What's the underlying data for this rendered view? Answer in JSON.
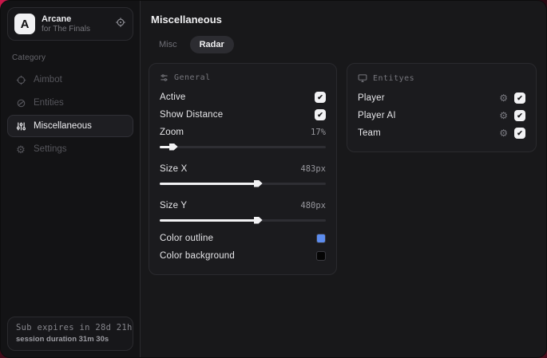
{
  "icons": {
    "check": "✔",
    "gear": "⚙"
  },
  "colors": {
    "accent_blue": "#5c8cee",
    "swatch_black": "#050505",
    "desktop_red": "#c9174a"
  },
  "sidebar": {
    "brand": {
      "initial": "A",
      "name": "Arcane",
      "subtitle": "for The Finals"
    },
    "category_label": "Category",
    "items": [
      {
        "label": "Aimbot",
        "icon": "crosshair",
        "active": false
      },
      {
        "label": "Entities",
        "icon": "scan",
        "active": false
      },
      {
        "label": "Miscellaneous",
        "icon": "sliders",
        "active": true
      },
      {
        "label": "Settings",
        "icon": "gear",
        "active": false
      }
    ],
    "footer": {
      "line1": "Sub expires in 28d 21h",
      "line2": "session duration 31m 30s"
    }
  },
  "main": {
    "title": "Miscellaneous",
    "tabs": [
      {
        "label": "Misc",
        "active": false
      },
      {
        "label": "Radar",
        "active": true
      }
    ],
    "general": {
      "header": "General",
      "active": {
        "label": "Active",
        "checked": true
      },
      "show_distance": {
        "label": "Show Distance",
        "checked": true
      },
      "zoom": {
        "label": "Zoom",
        "value": "17%",
        "percent": 7
      },
      "size_x": {
        "label": "Size X",
        "value": "483px",
        "percent": 58
      },
      "size_y": {
        "label": "Size Y",
        "value": "480px",
        "percent": 58
      },
      "color_outline": {
        "label": "Color outline",
        "color": "#5c8cee"
      },
      "color_background": {
        "label": "Color background",
        "color": "#050505"
      }
    },
    "entities": {
      "header": "Entityes",
      "rows": [
        {
          "label": "Player",
          "checked": true
        },
        {
          "label": "Player AI",
          "checked": true
        },
        {
          "label": "Team",
          "checked": true
        }
      ]
    }
  }
}
